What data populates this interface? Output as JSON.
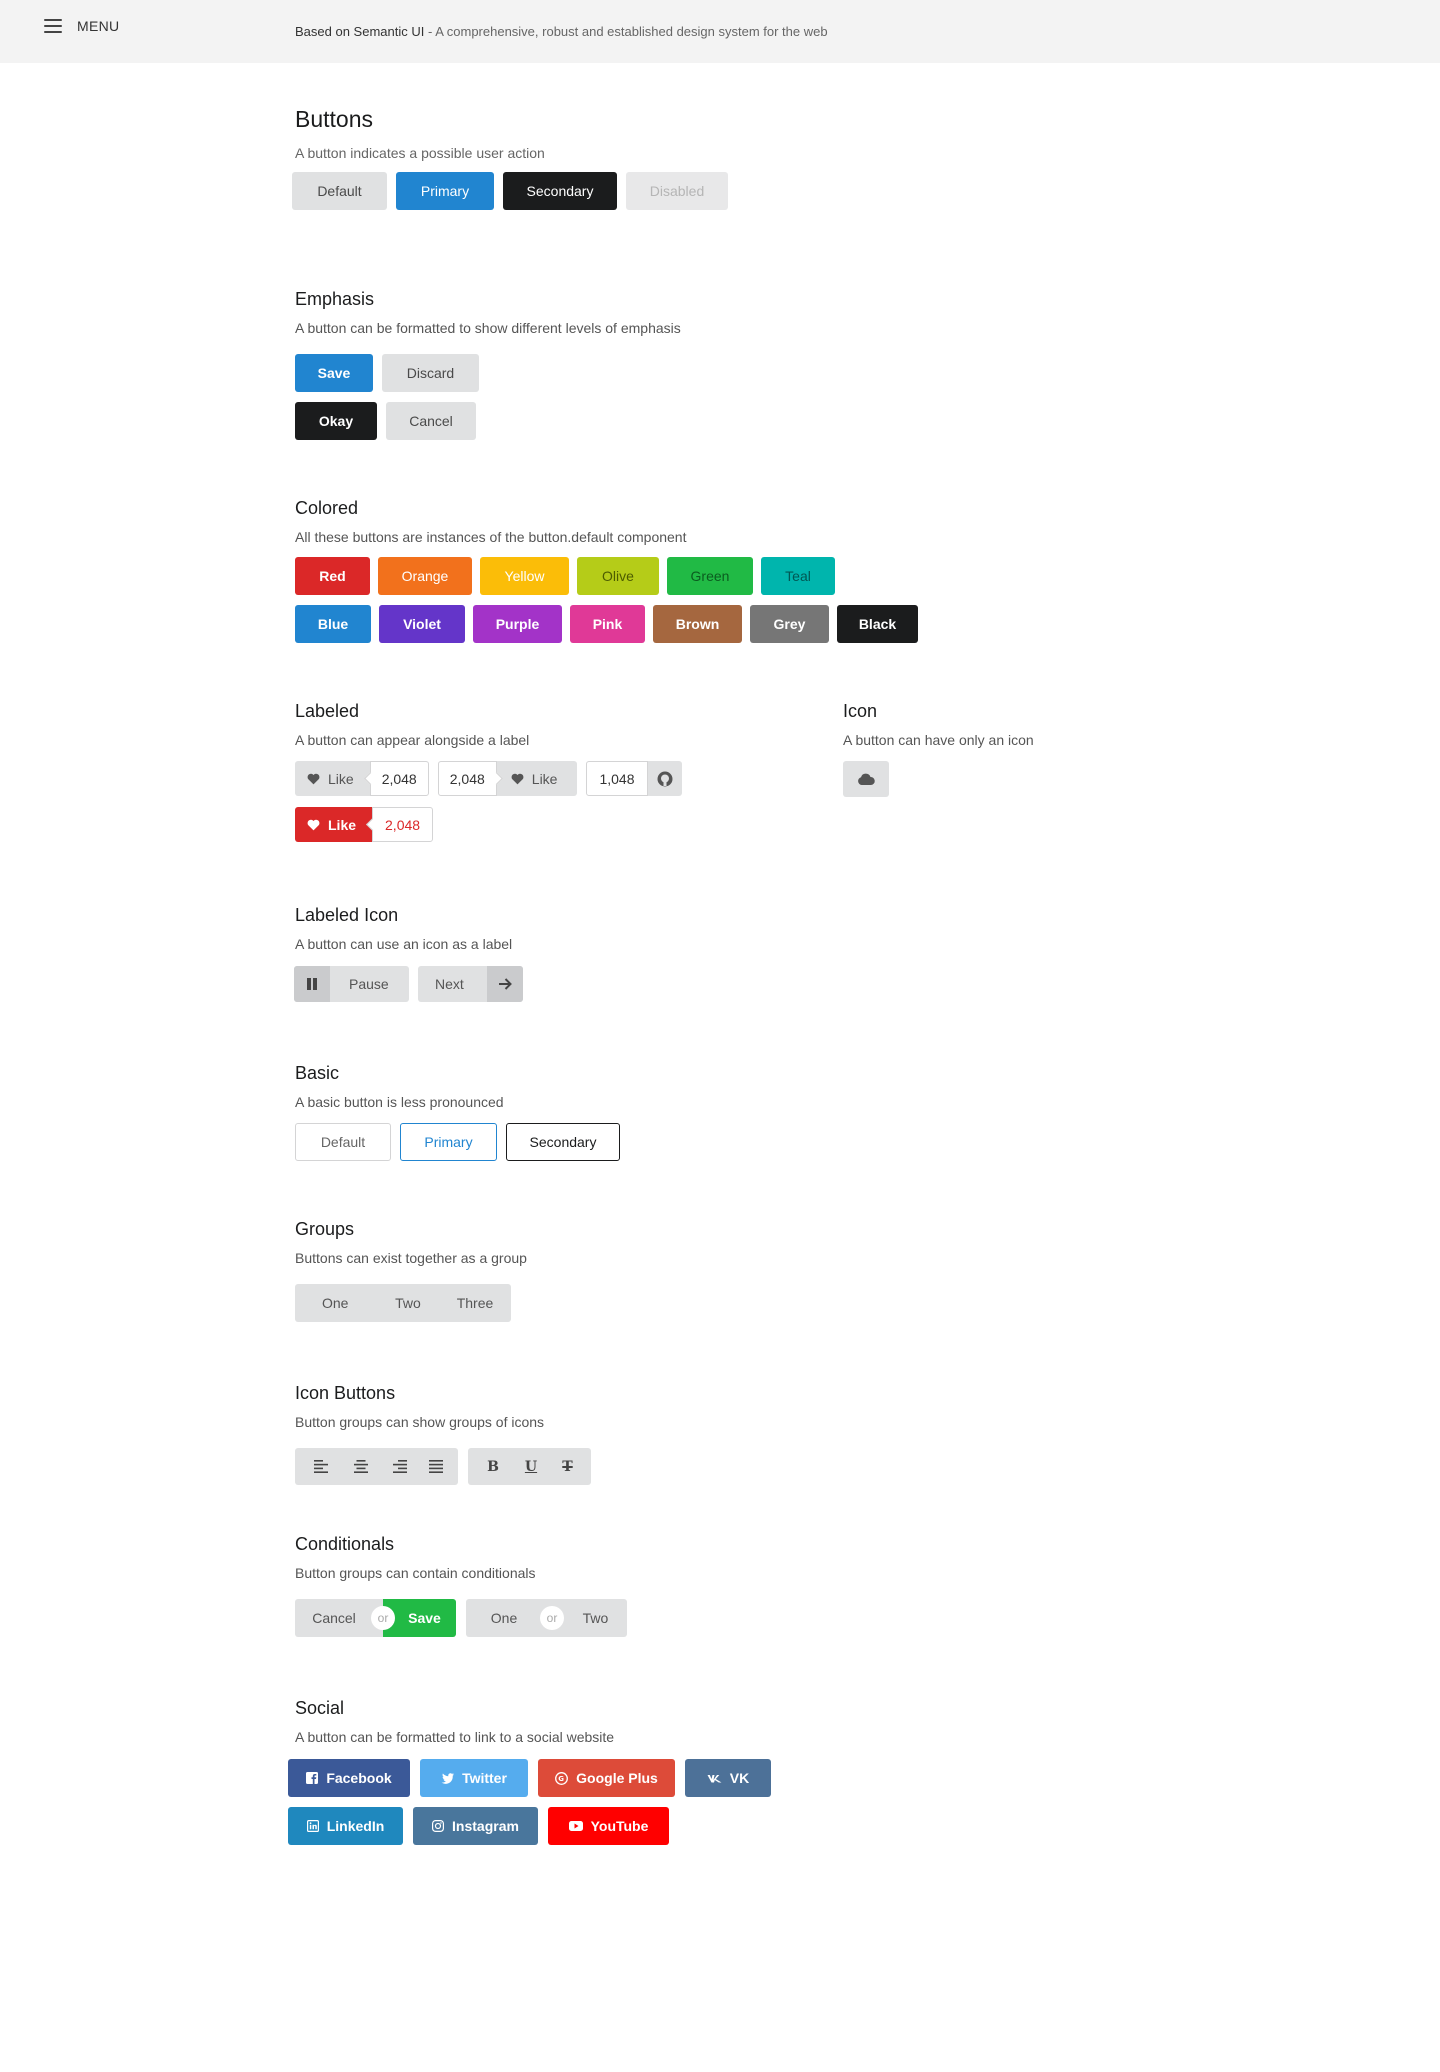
{
  "topbar": {
    "menu_label": "MENU",
    "tagline_brand": "Based on Semantic UI",
    "tagline_rest": " - A comprehensive, robust and established design system for the web"
  },
  "buttons": {
    "title": "Buttons",
    "description": "A button indicates a possible user action",
    "labels": [
      "Default",
      "Primary",
      "Secondary",
      "Disabled"
    ]
  },
  "emphasis": {
    "title": "Emphasis",
    "description": "A button can be formatted to show different levels of emphasis",
    "row1": [
      "Save",
      "Discard"
    ],
    "row2": [
      "Okay",
      "Cancel"
    ]
  },
  "colored": {
    "title": "Colored",
    "description": "All these buttons are instances of the button.default component",
    "row1": [
      "Red",
      "Orange",
      "Yellow",
      "Olive",
      "Green",
      "Teal"
    ],
    "row2": [
      "Blue",
      "Violet",
      "Purple",
      "Pink",
      "Brown",
      "Grey",
      "Black"
    ]
  },
  "labeled": {
    "title": "Labeled",
    "description": "A button can appear alongside a label",
    "like": "Like",
    "count": "2,048",
    "github_count": "1,048"
  },
  "icon": {
    "title": "Icon",
    "description": "A button can have only an icon",
    "icon_name": "cloud-icon"
  },
  "labeled_icon": {
    "title": "Labeled Icon",
    "description": "A button can use an icon as a label",
    "pause": "Pause",
    "next": "Next"
  },
  "basic": {
    "title": "Basic",
    "description": "A basic button is less pronounced",
    "labels": [
      "Default",
      "Primary",
      "Secondary"
    ]
  },
  "groups": {
    "title": "Groups",
    "description": "Buttons can exist together as a group",
    "labels": [
      "One",
      "Two",
      "Three"
    ]
  },
  "icon_buttons": {
    "title": "Icon Buttons",
    "description": "Button groups can show groups of icons",
    "align_icons": [
      "align-left-icon",
      "align-center-icon",
      "align-right-icon",
      "align-justify-icon"
    ],
    "format_labels": [
      "B",
      "U",
      "T"
    ]
  },
  "conditionals": {
    "title": "Conditionals",
    "description": "Button groups can contain conditionals",
    "group1": [
      "Cancel",
      "Save"
    ],
    "group2": [
      "One",
      "Two"
    ],
    "or": "or"
  },
  "social": {
    "title": "Social",
    "description": "A button can be formatted to link to a social website",
    "row1": [
      "Facebook",
      "Twitter",
      "Google Plus",
      "VK"
    ],
    "row2": [
      "LinkedIn",
      "Instagram",
      "YouTube"
    ]
  },
  "colors": {
    "primary": "#2185d0",
    "secondary": "#1b1c1d",
    "red": "#db2828",
    "green": "#21ba45"
  }
}
